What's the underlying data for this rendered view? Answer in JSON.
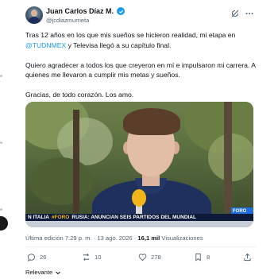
{
  "author": {
    "name": "Juan Carlos Díaz M.",
    "handle": "@jcdiazmurrieta",
    "verified": true
  },
  "tweet": {
    "para1_before": "Tras 12 años en los que mis sueños se hicieron realidad, mi etapa en ",
    "mention": "@TUDNMEX",
    "para1_after": " y Televisa llegó a su capítulo final.",
    "para2": "Quiero agradecer a todos los que creyeron en mí e impulsaron mi carrera. A quienes me llevaron a cumplir mis metas y sueños.",
    "para3": "Gracias, de todo corazón. Los amo."
  },
  "media": {
    "ticker": {
      "left": "N ITALIA",
      "tag": "#FORO",
      "headline": "RUSIA: ANUNCIAN SEIS PARTIDOS DEL MUNDIAL"
    },
    "badge": "FORO HI"
  },
  "meta": {
    "edited_label": "Última edición 7:29 p. m. · 13 ago. 2026 · ",
    "views_count": "16,1 mil",
    "views_label": " Visualizaciones"
  },
  "actions": {
    "replies": "26",
    "reposts": "10",
    "likes": "278",
    "bookmarks": "8"
  },
  "sort": {
    "label": "Relevante"
  },
  "colors": {
    "accent": "#1d9bf0",
    "text": "#0f1419",
    "muted": "#536471"
  }
}
